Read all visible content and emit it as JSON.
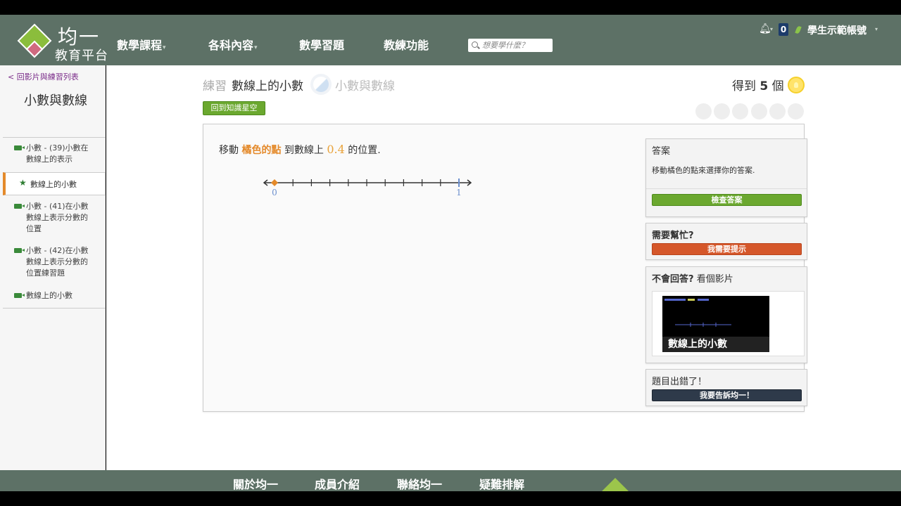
{
  "header": {
    "logo_title": "均一",
    "logo_subtitle": "教育平台",
    "nav": [
      {
        "label": "數學課程",
        "caret": true
      },
      {
        "label": "各科內容",
        "caret": true
      },
      {
        "label": "數學習題",
        "caret": false
      },
      {
        "label": "教練功能",
        "caret": false
      }
    ],
    "search_placeholder": "想要學什麼？",
    "notifications_count": "0",
    "user_name": "學生示範帳號",
    "colors": {
      "bar": "#5d7166"
    }
  },
  "sidebar": {
    "back_link": "< 回影片與練習列表",
    "topic_title": "小數與數線",
    "items": [
      {
        "label": "小數 - (39)小數在數線上的表示",
        "icon": "video-icon"
      },
      {
        "label": "數線上的小數",
        "icon": "star-icon",
        "active": true
      },
      {
        "label": "小數 - (41)在小數數線上表示分數的位置",
        "icon": "video-icon"
      },
      {
        "label": "小數 - (42)在小數數線上表示分數的位置練習題",
        "icon": "video-icon"
      },
      {
        "label": "數線上的小數",
        "icon": "video-icon"
      }
    ]
  },
  "exercise": {
    "label": "練習",
    "title": "數線上的小數",
    "topic": "小數與數線",
    "earn_prefix": "得到",
    "earn_count": "5",
    "earn_suffix": "個",
    "back_button": "回到知識星空",
    "streak_count": 6,
    "question": {
      "prefix": "移動",
      "highlight": "橘色的點",
      "middle": "到數線上",
      "target": "0.4",
      "suffix": "的位置."
    },
    "number_line": {
      "min_label": "0",
      "max_label": "1",
      "ticks": 11,
      "point_value": 0
    }
  },
  "answer_panel": {
    "title": "答案",
    "instruction": "移動橘色的點來選擇你的答案.",
    "check_button": "檢查答案"
  },
  "help_panel": {
    "title": "需要幫忙?",
    "hint_button": "我需要提示"
  },
  "video_panel": {
    "title_bold": "不會回答?",
    "title_rest": "看個影片",
    "video_caption": "數線上的小數"
  },
  "report_panel": {
    "title": "題目出錯了！",
    "report_button": "我要告訴均一！"
  },
  "footer": {
    "links": [
      "關於均一",
      "成員介紹",
      "聯絡均一",
      "疑難排解"
    ]
  }
}
